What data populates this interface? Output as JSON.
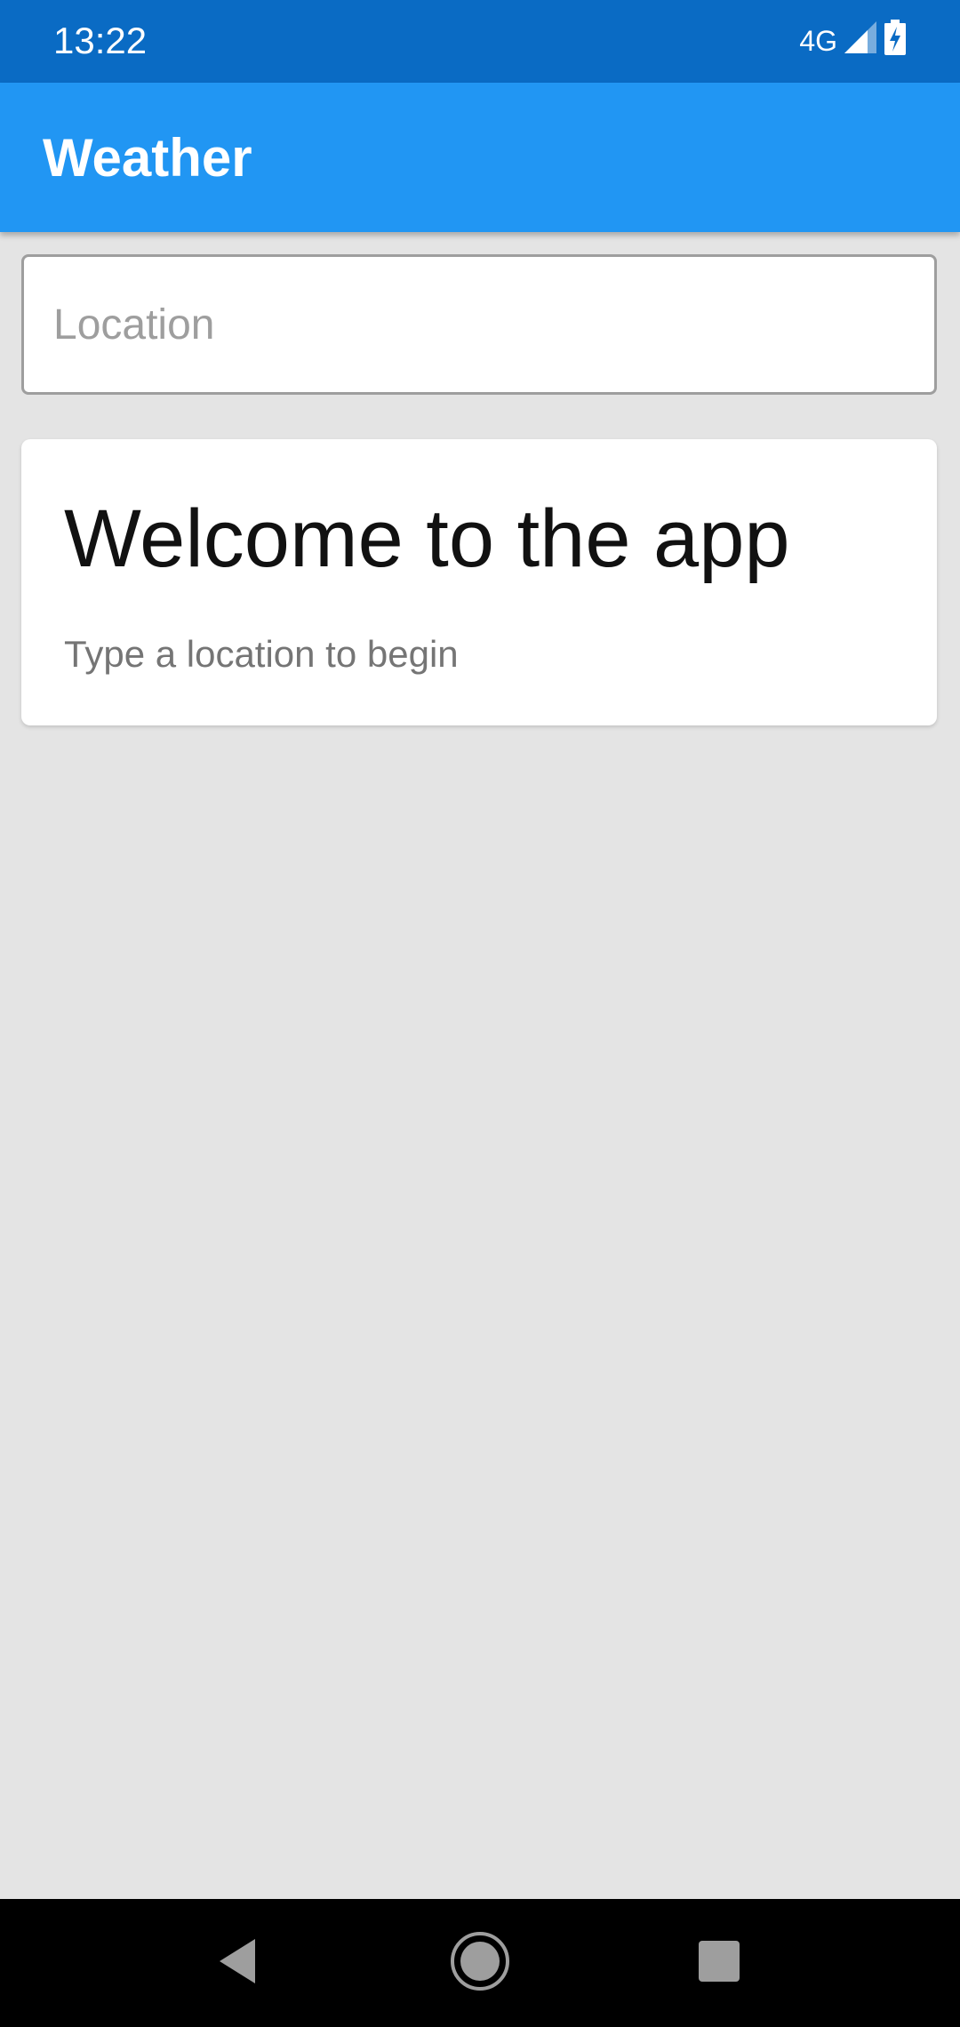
{
  "status_bar": {
    "time": "13:22",
    "network": "4G",
    "icons": [
      "signal-icon",
      "battery-charging-icon"
    ]
  },
  "app_bar": {
    "title": "Weather"
  },
  "search": {
    "value": "",
    "placeholder": "Location"
  },
  "welcome_card": {
    "title": "Welcome to the app",
    "subtitle": "Type a location to begin"
  },
  "navigation": {
    "icons": [
      "back-icon",
      "home-icon",
      "recents-icon"
    ]
  },
  "colors": {
    "status_bar": "#0a6bc4",
    "app_bar": "#2196f3",
    "background": "#e4e4e4",
    "card": "#ffffff",
    "nav_bar": "#000000"
  }
}
